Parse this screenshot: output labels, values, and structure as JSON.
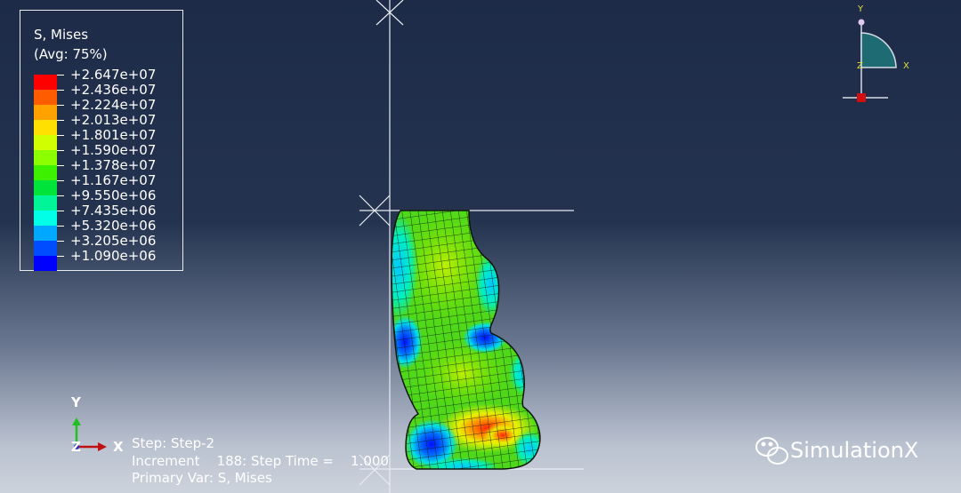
{
  "legend": {
    "title": "S, Mises",
    "subtitle": "(Avg: 75%)",
    "levels": [
      "+2.647e+07",
      "+2.436e+07",
      "+2.224e+07",
      "+2.013e+07",
      "+1.801e+07",
      "+1.590e+07",
      "+1.378e+07",
      "+1.167e+07",
      "+9.550e+06",
      "+7.435e+06",
      "+5.320e+06",
      "+3.205e+06",
      "+1.090e+06"
    ],
    "colors": [
      "#ff0000",
      "#ff5c00",
      "#ffa200",
      "#ffe000",
      "#cfff00",
      "#8cff00",
      "#3cf000",
      "#00e33b",
      "#00f598",
      "#00ffe6",
      "#00a8ff",
      "#004cff",
      "#0000ff"
    ]
  },
  "triad_main": {
    "y": "Y",
    "x": "X",
    "z": "Z"
  },
  "triad_small": {
    "y": "Y",
    "x": "X",
    "z": "Z"
  },
  "status": {
    "step": "Step: Step-2",
    "increment": "Increment    188: Step Time =    1.000",
    "primary_var": "Primary Var: S, Mises"
  },
  "watermark": "SimulationX",
  "icons": [
    "wechat-icon"
  ]
}
